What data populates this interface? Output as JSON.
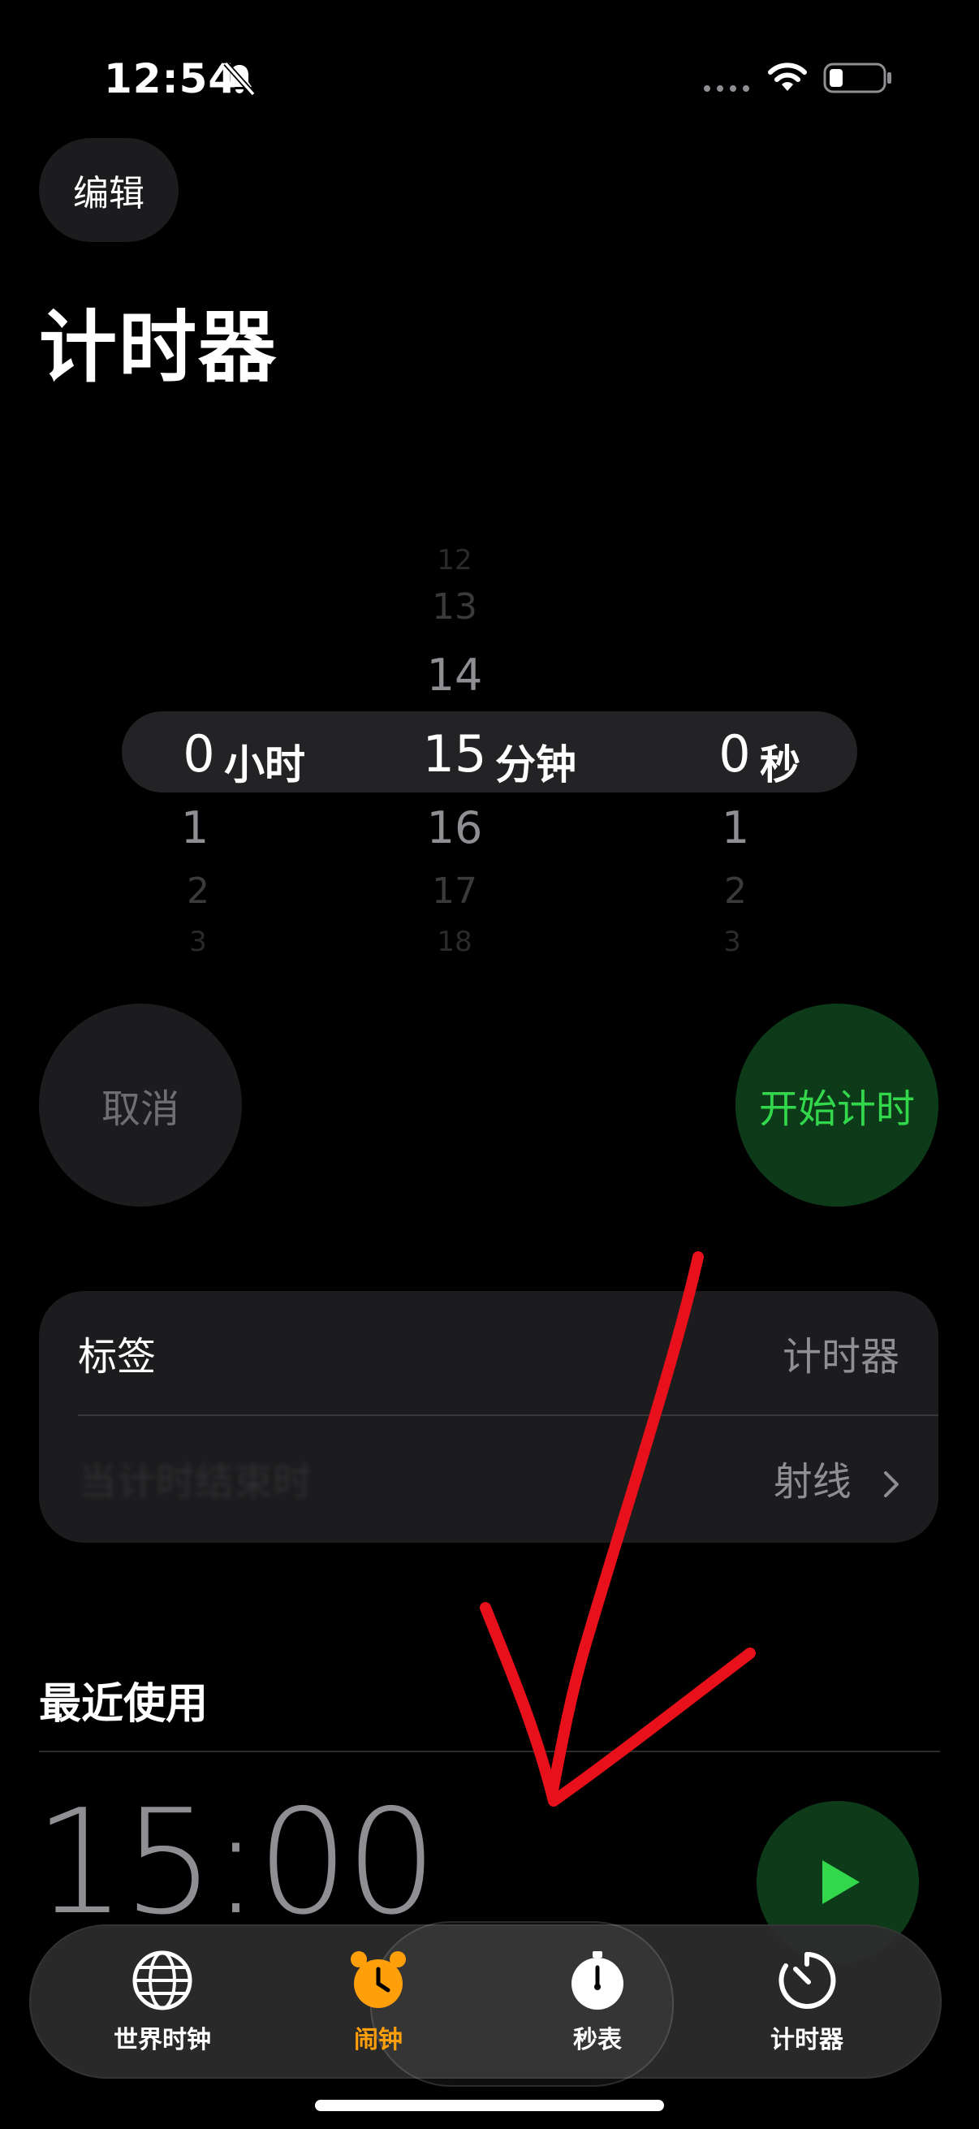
{
  "status_bar": {
    "time": "12:54"
  },
  "header": {
    "edit_label": "编辑",
    "title": "计时器"
  },
  "picker": {
    "hours": {
      "above": [
        "",
        "",
        ""
      ],
      "selected": "0",
      "below": [
        "1",
        "2",
        "3"
      ],
      "unit": "小时"
    },
    "minutes": {
      "above": [
        "12",
        "13",
        "14"
      ],
      "selected": "15",
      "below": [
        "16",
        "17",
        "18"
      ],
      "unit": "分钟"
    },
    "seconds": {
      "above": [
        "",
        "",
        ""
      ],
      "selected": "0",
      "below": [
        "1",
        "2",
        "3"
      ],
      "unit": "秒"
    }
  },
  "controls": {
    "cancel_label": "取消",
    "start_label": "开始计时"
  },
  "settings": {
    "label_row": {
      "label": "标签",
      "value": "计时器"
    },
    "sound_row": {
      "label": "当计时结束时",
      "value": "射线"
    }
  },
  "recent": {
    "title": "最近使用",
    "items": [
      {
        "time": "15:00"
      }
    ]
  },
  "tab_bar": {
    "tabs": [
      {
        "label": "世界时钟",
        "icon": "globe-icon"
      },
      {
        "label": "闹钟",
        "icon": "alarm-icon"
      },
      {
        "label": "秒表",
        "icon": "stopwatch-icon"
      },
      {
        "label": "计时器",
        "icon": "timer-icon"
      }
    ],
    "active_index": 3
  },
  "colors": {
    "accent_green": "#32d74b",
    "accent_orange": "#ff9f0a",
    "annotation_red": "#e8101a"
  }
}
